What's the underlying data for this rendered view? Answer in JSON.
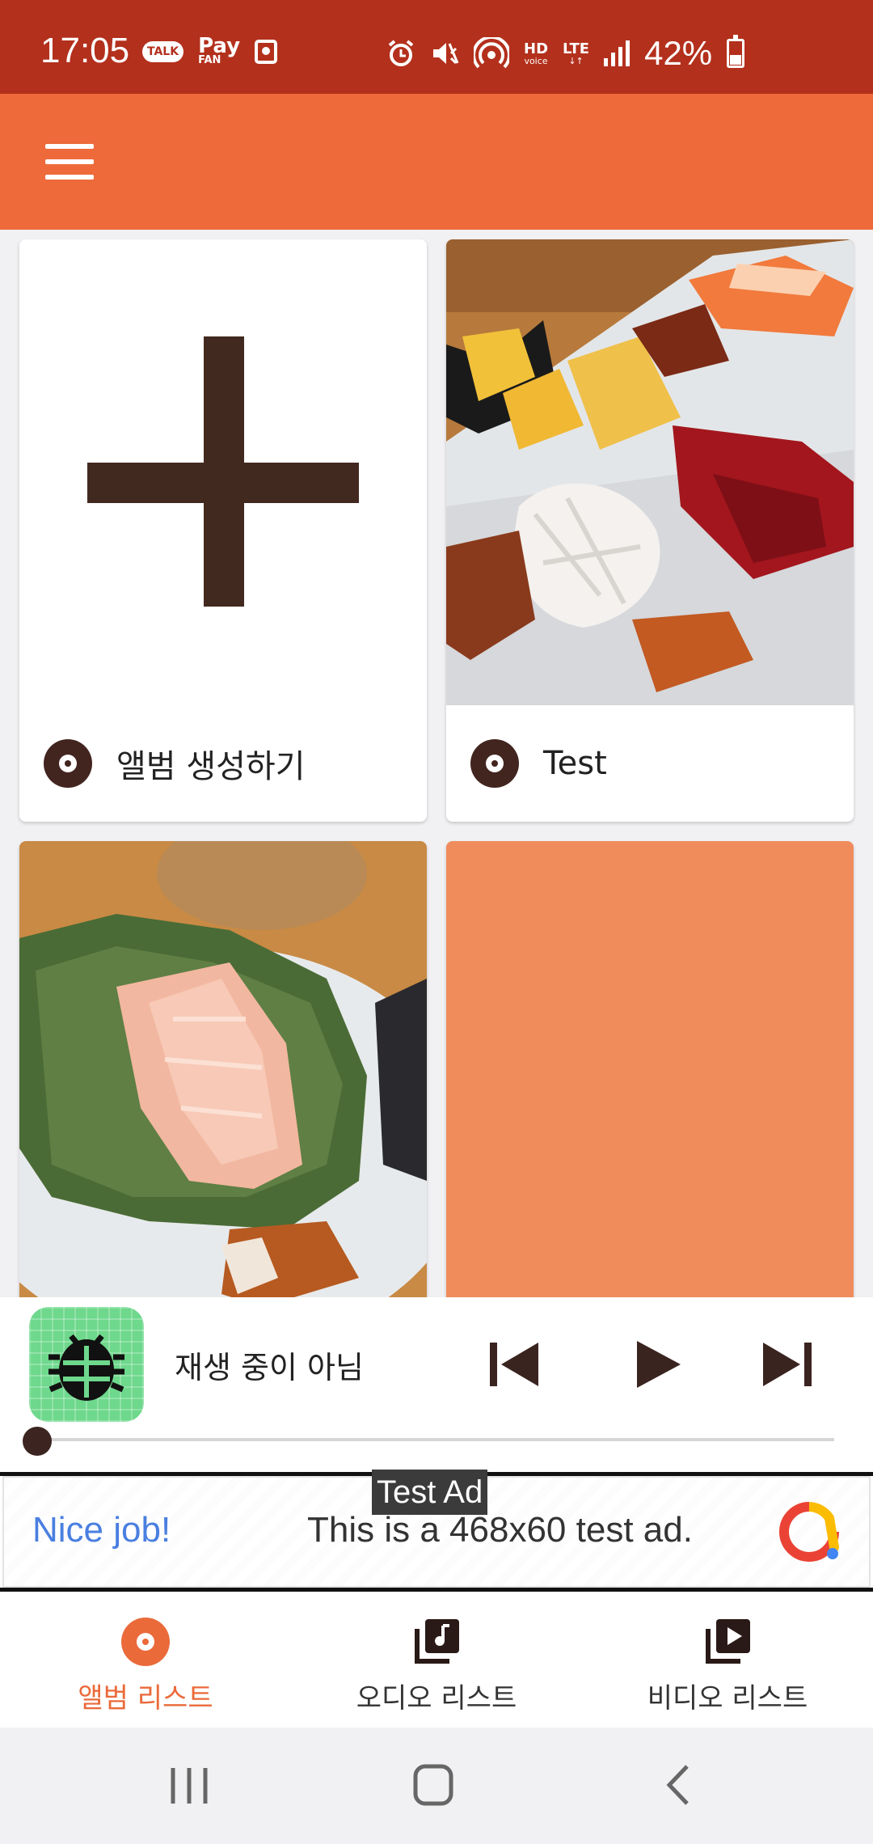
{
  "status_bar": {
    "time": "17:05",
    "talk_badge": "TALK",
    "pay_label": "Pay",
    "pay_sub": "FAN",
    "hd_label": "HD",
    "hd_sub": "voice",
    "lte_label": "LTE",
    "battery_percent": "42%",
    "icons": [
      "kakaotalk-icon",
      "payfan-icon",
      "screen-record-icon",
      "alarm-icon",
      "mute-icon",
      "hotspot-icon",
      "hd-voice-icon",
      "lte-icon",
      "signal-icon",
      "battery-icon"
    ]
  },
  "app_bar": {
    "icon": "menu-icon",
    "color": "#ee6a3a"
  },
  "albums": [
    {
      "label": "앨범 생성하기",
      "thumbnail": "plus-icon",
      "color": "#42291f"
    },
    {
      "label": "Test",
      "thumbnail": "sushi-photo"
    },
    {
      "label": "",
      "thumbnail": "salmon-photo"
    },
    {
      "label": "",
      "thumbnail": "orange-placeholder",
      "color": "#f08c5c"
    }
  ],
  "player": {
    "status": "재생 중이 아님",
    "artwork": "bug-icon",
    "progress": 0,
    "controls": [
      "skip-previous-icon",
      "play-icon",
      "skip-next-icon"
    ]
  },
  "ad": {
    "tag": "Test Ad",
    "headline": "Nice job!",
    "message": "This is a 468x60 test ad.",
    "logo": "google-ads-logo"
  },
  "bottom_nav": {
    "items": [
      {
        "label": "앨범 리스트",
        "icon": "album-disc-icon",
        "active": true
      },
      {
        "label": "오디오 리스트",
        "icon": "audio-library-icon",
        "active": false
      },
      {
        "label": "비디오 리스트",
        "icon": "video-library-icon",
        "active": false
      }
    ],
    "active_color": "#ea6a3a"
  },
  "system_nav": {
    "icons": [
      "recents-icon",
      "home-icon",
      "back-icon"
    ]
  }
}
